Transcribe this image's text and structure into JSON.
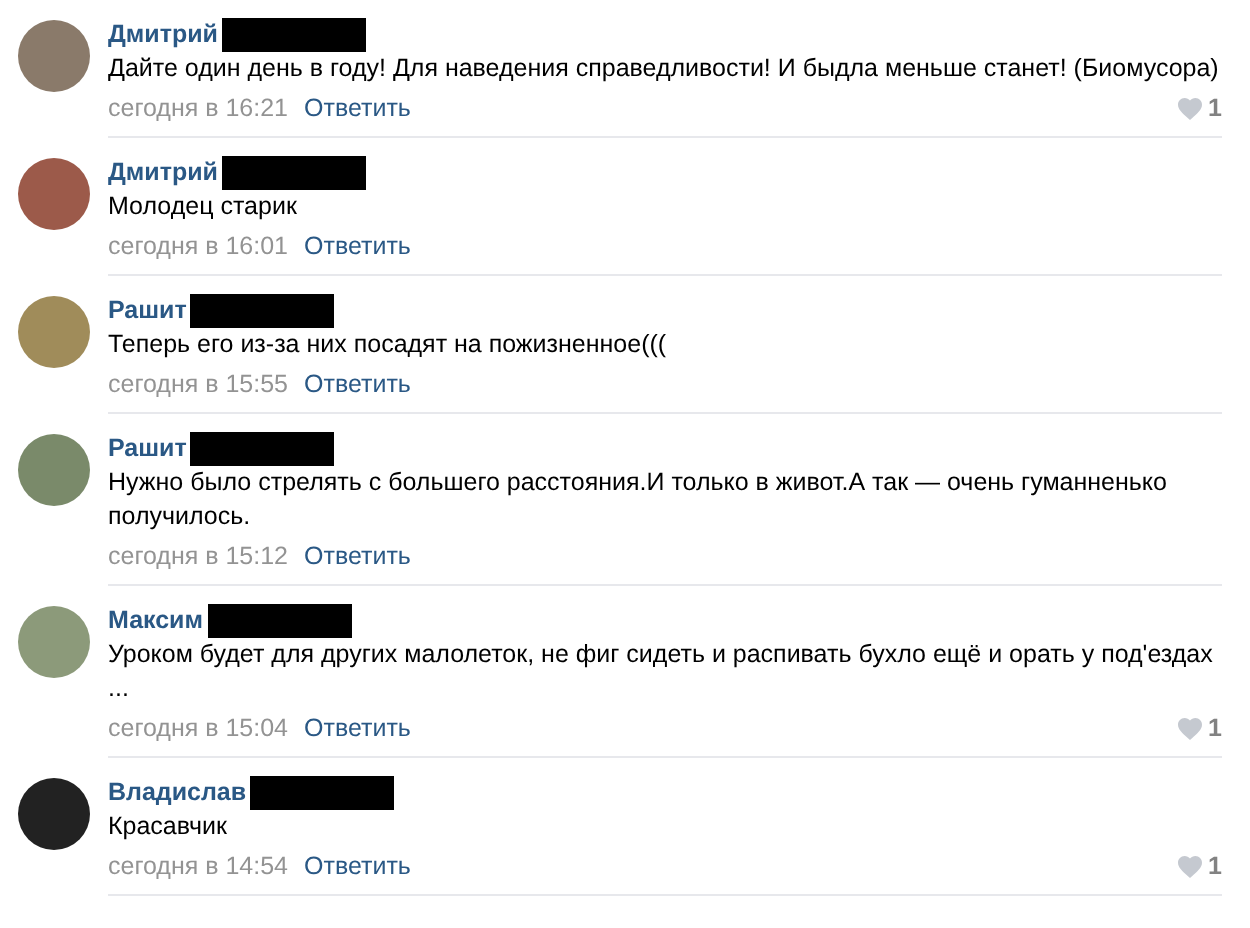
{
  "comments": [
    {
      "author": "Дмитрий",
      "text": "Дайте один день в году! Для наведения справедливости! И быдла меньше станет! (Биомусора)",
      "time": "сегодня в 16:21",
      "reply": "Ответить",
      "likes": "1"
    },
    {
      "author": "Дмитрий",
      "text": "Молодец старик",
      "time": "сегодня в 16:01",
      "reply": "Ответить"
    },
    {
      "author": "Рашит",
      "text": "Теперь его из-за них посадят на пожизненное(((",
      "time": "сегодня в 15:55",
      "reply": "Ответить"
    },
    {
      "author": "Рашит",
      "text": "Нужно было стрелять с большего расстояния.И только в живот.А так — очень гуманненько получилось.",
      "time": "сегодня в 15:12",
      "reply": "Ответить"
    },
    {
      "author": "Максим",
      "text": "Уроком будет для других малолеток, не фиг сидеть и распивать бухло ещё и орать у под'ездах ...",
      "time": "сегодня в 15:04",
      "reply": "Ответить",
      "likes": "1"
    },
    {
      "author": "Владислав",
      "text": "Красавчик",
      "time": "сегодня в 14:54",
      "reply": "Ответить",
      "likes": "1"
    }
  ]
}
